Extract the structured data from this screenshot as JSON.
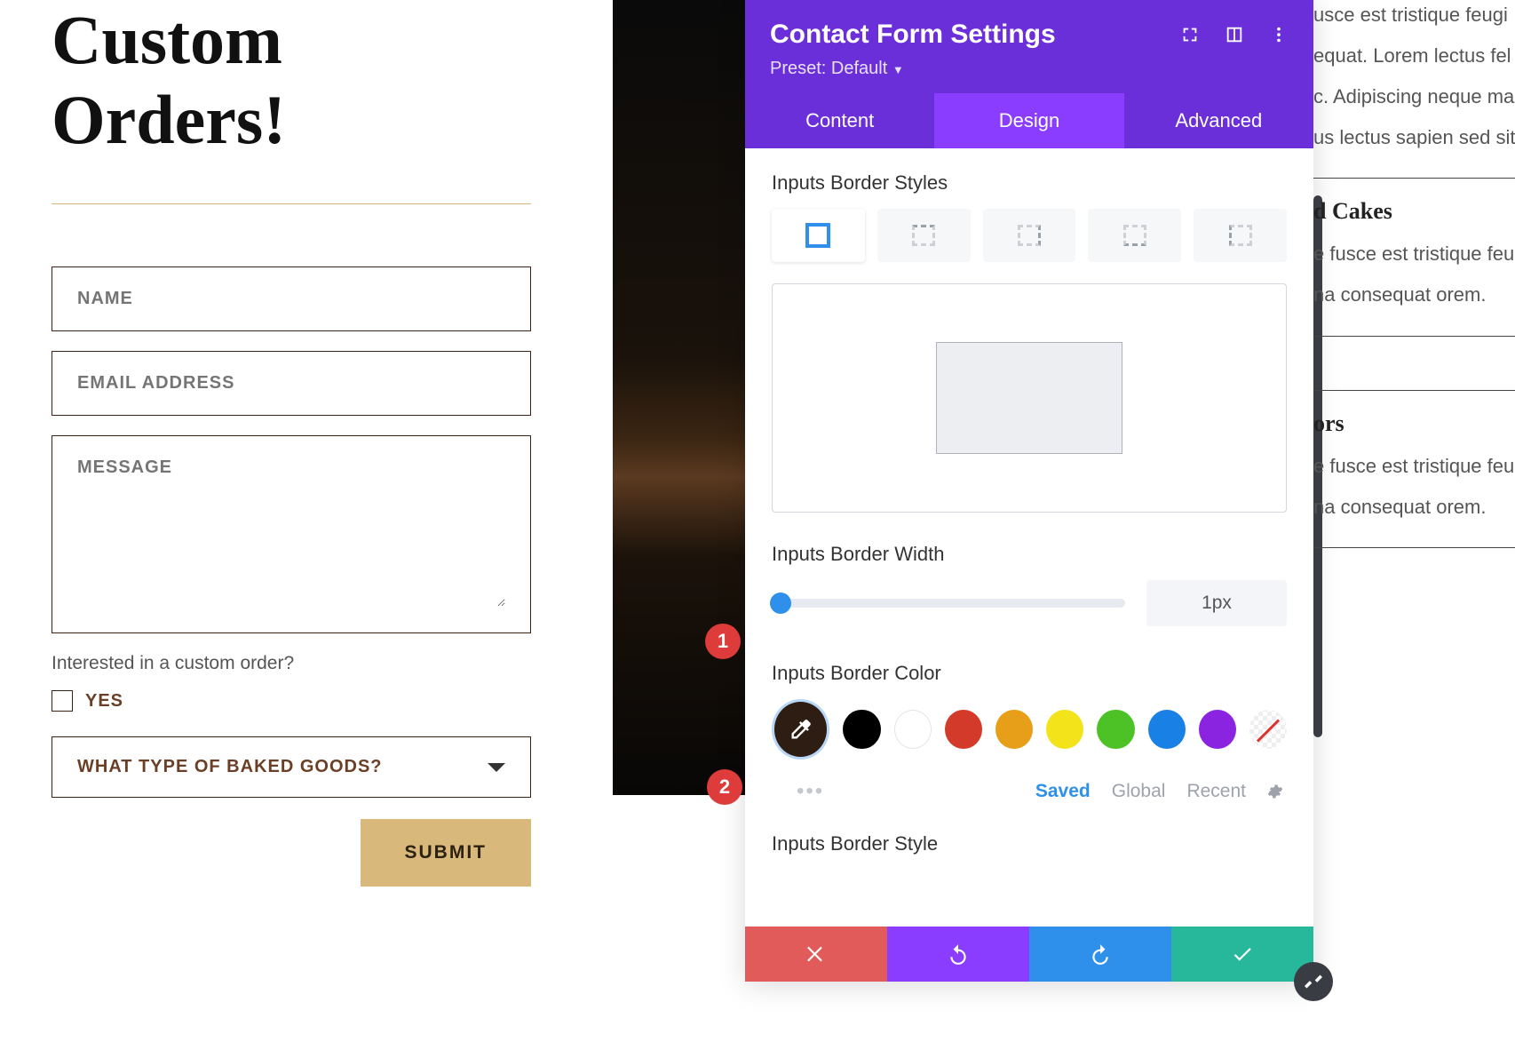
{
  "heading": "Custom Orders!",
  "form": {
    "name_placeholder": "NAME",
    "email_placeholder": "EMAIL ADDRESS",
    "message_placeholder": "MESSAGE",
    "question": "Interested in a custom order?",
    "checkbox_label": "YES",
    "dropdown_label": "WHAT TYPE OF BAKED GOODS?",
    "submit_label": "SUBMIT"
  },
  "panel": {
    "title": "Contact Form Settings",
    "preset": "Preset: Default",
    "tabs": {
      "content": "Content",
      "design": "Design",
      "advanced": "Advanced",
      "active": "design"
    },
    "sections": {
      "border_styles": "Inputs Border Styles",
      "border_width": "Inputs Border Width",
      "border_color": "Inputs Border Color",
      "border_style": "Inputs Border Style"
    },
    "border_width_value": "1px",
    "color_swatches": [
      "#2e1d13",
      "#000000",
      "#ffffff",
      "#d43a2a",
      "#e79e19",
      "#f3e31b",
      "#4dc227",
      "#1981e6",
      "#8a24e0"
    ],
    "color_tabs": {
      "saved": "Saved",
      "global": "Global",
      "recent": "Recent"
    }
  },
  "annotations": {
    "one": "1",
    "two": "2"
  },
  "right": {
    "p1": "usce est tristique feugi",
    "p2": "equat. Lorem lectus fel",
    "p3": "c. Adipiscing neque ma",
    "p4": "us lectus sapien sed sit",
    "h1": "d Cakes",
    "p5": "e fusce est tristique feugi",
    "p6": "na consequat orem.",
    "h2": "ors",
    "p7": "e fusce est tristique feugi",
    "p8": "na consequat orem."
  }
}
